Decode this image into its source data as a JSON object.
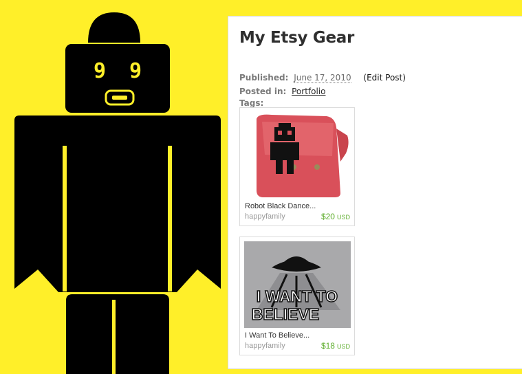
{
  "robot": {
    "eye_left": "9",
    "eye_right": "9"
  },
  "post": {
    "title": "My Etsy Gear",
    "published_label": "Published:",
    "published_date": "June 17, 2010",
    "edit_link": "(Edit Post)",
    "posted_in_label": "Posted in:",
    "category": "Portfolio",
    "tags_label": "Tags:"
  },
  "items": [
    {
      "title": "Robot Black Dance...",
      "shop": "happyfamily",
      "price": "$20",
      "currency": "USD"
    },
    {
      "title": "I Want To Believe...",
      "shop": "happyfamily",
      "price": "$18",
      "currency": "USD",
      "image_text_line1": "I WANT TO",
      "image_text_line2": "BELIEVE"
    }
  ]
}
